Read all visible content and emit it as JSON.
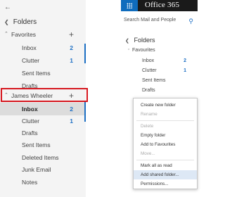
{
  "left": {
    "title": "Folders",
    "favorites": {
      "label": "Favorites",
      "items": [
        {
          "label": "Inbox",
          "count": "2"
        },
        {
          "label": "Clutter",
          "count": "1"
        },
        {
          "label": "Sent Items",
          "count": ""
        },
        {
          "label": "Drafts",
          "count": ""
        }
      ]
    },
    "account": {
      "label": "James Wheeler",
      "items": [
        {
          "label": "Inbox",
          "count": "2"
        },
        {
          "label": "Clutter",
          "count": "1"
        },
        {
          "label": "Drafts",
          "count": ""
        },
        {
          "label": "Sent Items",
          "count": ""
        },
        {
          "label": "Deleted Items",
          "count": ""
        },
        {
          "label": "Junk Email",
          "count": ""
        },
        {
          "label": "Notes",
          "count": ""
        }
      ]
    }
  },
  "right": {
    "brand": "Office 365",
    "search_placeholder": "Search Mail and People",
    "title": "Folders",
    "favourites": {
      "label": "Favourites",
      "items": [
        {
          "label": "Inbox",
          "count": "2"
        },
        {
          "label": "Clutter",
          "count": "1"
        },
        {
          "label": "Sent Items",
          "count": ""
        },
        {
          "label": "Drafts",
          "count": ""
        }
      ]
    },
    "menu": [
      {
        "label": "Create new folder",
        "disabled": false
      },
      {
        "label": "Rename",
        "disabled": true
      },
      {
        "label": "Delete",
        "disabled": true
      },
      {
        "label": "Empty folder",
        "disabled": false
      },
      {
        "label": "Add to Favourites",
        "disabled": false
      },
      {
        "label": "Move...",
        "disabled": true
      },
      {
        "label": "Mark all as read",
        "disabled": false
      },
      {
        "label": "Add shared folder...",
        "disabled": false
      },
      {
        "label": "Permissions...",
        "disabled": false
      }
    ]
  },
  "colors": {
    "accent": "#1d6fc4",
    "highlight_border": "#d6171e",
    "topbar": "#1a1a1a",
    "waffle": "#0f6cbd",
    "menu_hover": "#dde8f5"
  }
}
